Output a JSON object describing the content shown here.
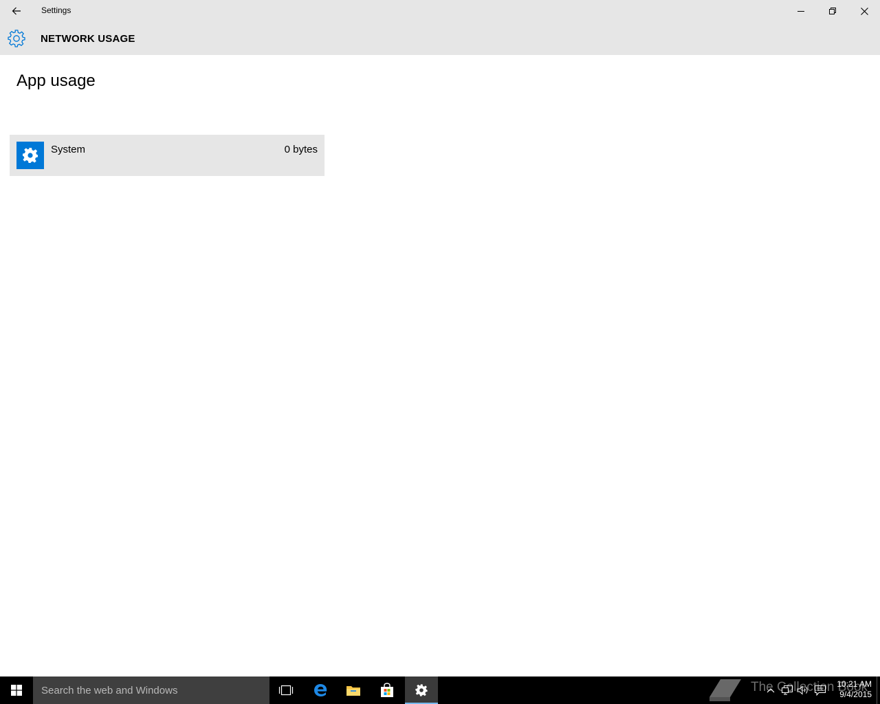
{
  "window": {
    "title": "Settings",
    "back_icon": "back-arrow-icon",
    "minimize_icon": "minimize-icon",
    "restore_icon": "restore-icon",
    "close_icon": "close-icon"
  },
  "header": {
    "icon": "gear-icon",
    "title": "NETWORK USAGE",
    "accent_color": "#0078d7"
  },
  "main": {
    "heading": "App usage",
    "apps": [
      {
        "name": "System",
        "usage": "0 bytes",
        "icon": "gear-icon",
        "tile_color": "#0078d7"
      }
    ]
  },
  "taskbar": {
    "start_icon": "windows-logo-icon",
    "search_placeholder": "Search the web and Windows",
    "pinned": [
      {
        "name": "Task View",
        "icon": "task-view-icon"
      },
      {
        "name": "Microsoft Edge",
        "icon": "edge-icon"
      },
      {
        "name": "File Explorer",
        "icon": "folder-icon"
      },
      {
        "name": "Store",
        "icon": "store-icon"
      },
      {
        "name": "Settings",
        "icon": "gear-icon",
        "active": true
      }
    ],
    "watermark": "The Collection Book",
    "tray_icons": [
      "chevron-up-icon",
      "network-icon",
      "volume-icon",
      "action-center-icon"
    ],
    "clock": {
      "time": "10:21 AM",
      "date": "9/4/2015"
    }
  }
}
